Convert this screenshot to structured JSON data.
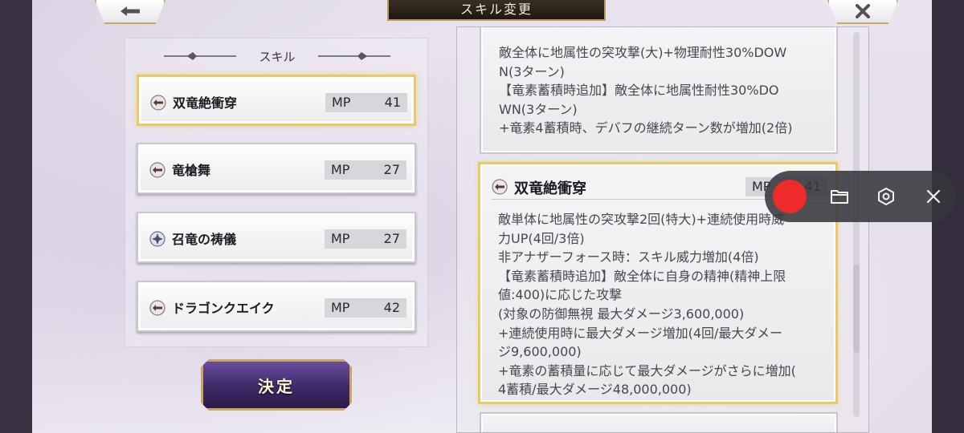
{
  "header": {
    "title": "スキル変更",
    "back_icon": "arrow-left-icon",
    "close_icon": "close-icon"
  },
  "skill_panel": {
    "heading": "スキル",
    "items": [
      {
        "name": "双竜絶衝穿",
        "mp_label": "MP",
        "mp": "41",
        "icon": "spear-icon",
        "selected": true
      },
      {
        "name": "竜槍舞",
        "mp_label": "MP",
        "mp": "27",
        "icon": "spear-icon",
        "selected": false
      },
      {
        "name": "召竜の祷儀",
        "mp_label": "MP",
        "mp": "27",
        "icon": "crystal-icon",
        "selected": false
      },
      {
        "name": "ドラゴンクエイク",
        "mp_label": "MP",
        "mp": "42",
        "icon": "spear-icon",
        "selected": false
      }
    ],
    "decide_label": "決定"
  },
  "details": {
    "prev_card_text": "敵全体に地属性の突攻撃(大)+物理耐性30%DOW\nN(3ターン)\n【竜素蓄積時追加】敵全体に地属性耐性30%DO\nWN(3ターン)\n+竜素4蓄積時、デバフの継続ターン数が増加(2倍)",
    "selected_card": {
      "name": "双竜絶衝穿",
      "mp_label": "MP",
      "mp": "41",
      "text": "敵単体に地属性の突攻撃2回(特大)+連続使用時威\n力UP(4回/3倍)\n非アナザーフォース時：スキル威力増加(4倍)\n【竜素蓄積時追加】敵全体に自身の精神(精神上限\n値:400)に応じた攻撃\n(対象の防御無視 最大ダメージ3,600,000)\n+連続使用時に最大ダメージ増加(4回/最大ダメー\nジ9,600,000)\n+竜素の蓄積量に応じて最大ダメージがさらに増加(\n4蓄積/最大ダメージ48,000,000)"
    }
  },
  "recorder_toolbar": {
    "record_color": "#ee2b2b",
    "tools": [
      "folder-icon",
      "settings-icon",
      "close-icon"
    ]
  },
  "colors": {
    "gold_border": "#e7c86a",
    "panel_bg": "#ecebee",
    "decide_bg": "#3d2a66"
  }
}
